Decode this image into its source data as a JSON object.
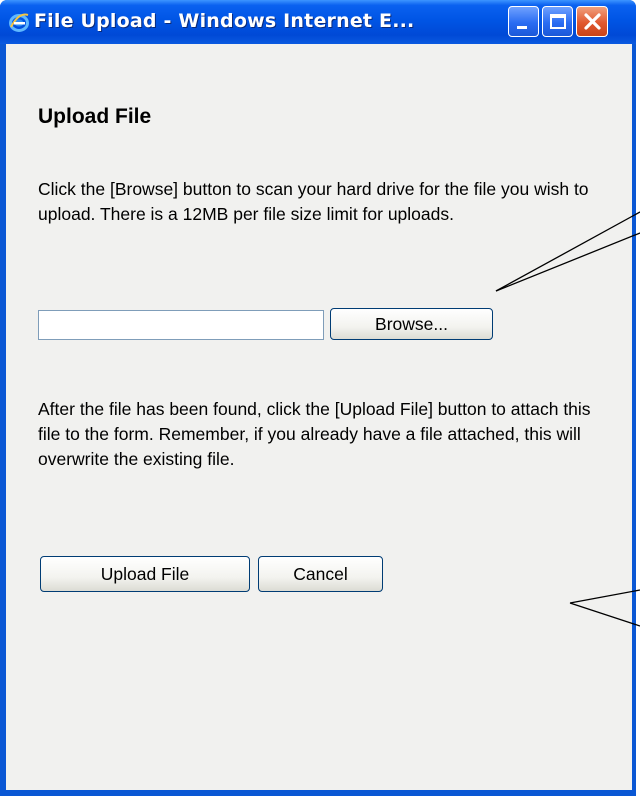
{
  "window": {
    "title": "File Upload - Windows Internet E...",
    "controls": [
      "minimize",
      "maximize",
      "close"
    ]
  },
  "page": {
    "heading": "Upload File",
    "instructions_1": "Click the [Browse] button to scan your hard drive for the file you wish to upload. There is a 12MB per file size limit for uploads.",
    "file_field": {
      "value": "",
      "placeholder": ""
    },
    "browse_label": "Browse...",
    "instructions_2": "After the file has been found, click the [Upload File] button to attach this file to the form. Remember, if you already have a file attached, this will overwrite the existing file.",
    "upload_label": "Upload File",
    "cancel_label": "Cancel"
  },
  "colors": {
    "titlebar": "#0055e5",
    "client_background": "#f1f1ef",
    "close_button": "#e1582f"
  },
  "icons": [
    "ie-icon",
    "minimize-icon",
    "maximize-icon",
    "close-icon"
  ]
}
